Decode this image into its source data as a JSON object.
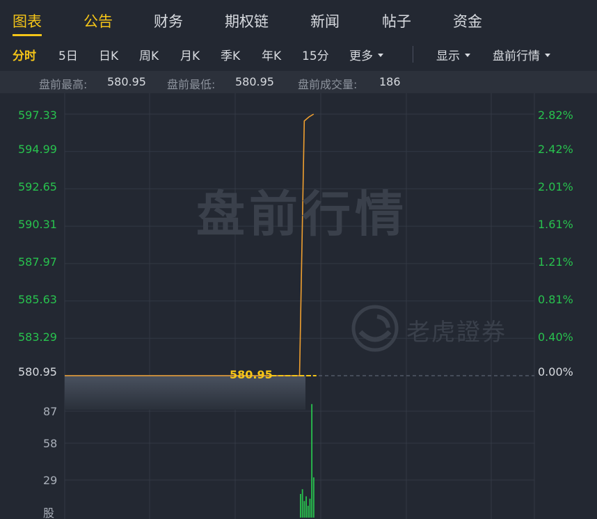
{
  "top_tabs": [
    "图表",
    "公告",
    "财务",
    "期权链",
    "新闻",
    "帖子",
    "资金"
  ],
  "period_tabs": [
    "分时",
    "5日",
    "日K",
    "周K",
    "月K",
    "季K",
    "年K",
    "15分"
  ],
  "more_label": "更多",
  "display_label": "显示",
  "premarket_label": "盘前行情",
  "stats": {
    "high_label": "盘前最高:",
    "high_value": "580.95",
    "low_label": "盘前最低:",
    "low_value": "580.95",
    "volume_label": "盘前成交量:",
    "volume_value": "186"
  },
  "watermark_text": "盘前行情",
  "logo_text": "老虎證券",
  "current_price_tag": "580.95",
  "volume_unit": "股",
  "colors": {
    "accent": "#f5c518",
    "up": "#28c24e",
    "line": "#f0a030"
  },
  "chart_data": {
    "type": "line",
    "y_left_ticks": [
      "597.33",
      "594.99",
      "592.65",
      "590.31",
      "587.97",
      "585.63",
      "583.29",
      "580.95"
    ],
    "y_right_ticks": [
      "2.82%",
      "2.42%",
      "2.01%",
      "1.61%",
      "1.21%",
      "0.81%",
      "0.40%",
      "0.00%"
    ],
    "ylim": [
      580.95,
      597.33
    ],
    "base_price": 580.95,
    "price_series": [
      {
        "t": 0,
        "v": 580.95
      },
      {
        "t": 0.5,
        "v": 580.95
      },
      {
        "t": 0.51,
        "v": 596.9
      },
      {
        "t": 0.52,
        "v": 597.15
      },
      {
        "t": 0.53,
        "v": 597.33
      }
    ],
    "volume_ticks": [
      "87",
      "58",
      "29"
    ],
    "volume_max": 100,
    "volume_bars": [
      {
        "t": 0.502,
        "v": 20
      },
      {
        "t": 0.506,
        "v": 24
      },
      {
        "t": 0.51,
        "v": 14
      },
      {
        "t": 0.514,
        "v": 18
      },
      {
        "t": 0.518,
        "v": 10
      },
      {
        "t": 0.522,
        "v": 16
      },
      {
        "t": 0.526,
        "v": 96
      },
      {
        "t": 0.53,
        "v": 34
      }
    ]
  }
}
